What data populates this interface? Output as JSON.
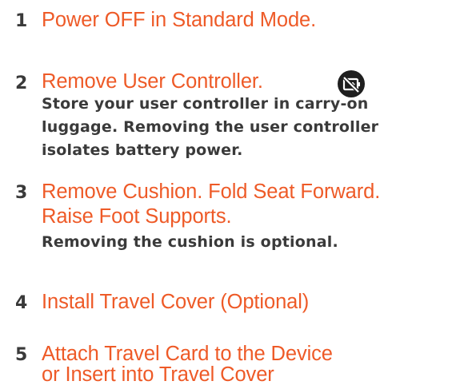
{
  "steps": [
    {
      "number": "1",
      "title_lines": [
        "Power OFF in Standard Mode."
      ],
      "desc_lines": []
    },
    {
      "number": "2",
      "title_lines": [
        "Remove User Controller."
      ],
      "desc_lines": [
        "Store your user controller in carry-on",
        "luggage. Removing the user controller",
        "isolates battery power."
      ],
      "icon": "battery-disconnected-icon"
    },
    {
      "number": "3",
      "title_lines": [
        "Remove Cushion. Fold Seat Forward.",
        "Raise Foot Supports."
      ],
      "desc_lines": [
        "Removing the cushion is optional."
      ]
    },
    {
      "number": "4",
      "title_lines": [
        "Install Travel Cover (Optional)"
      ],
      "desc_lines": []
    },
    {
      "number": "5",
      "title_lines": [
        "Attach Travel Card to the Device",
        "or Insert into Travel Cover"
      ],
      "desc_lines": []
    }
  ],
  "colors": {
    "title": "#ee5a27",
    "text": "#3a3a3a",
    "icon_bg": "#1f1f1f"
  }
}
